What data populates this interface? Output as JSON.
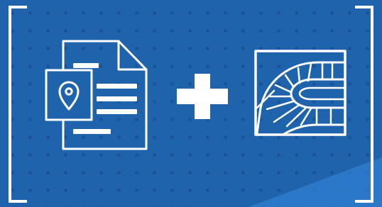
{
  "scene": {
    "background_color": "#1f63ad",
    "dot_color": "#1a5396",
    "corner_accent_color": "#2f7fd0",
    "foreground_color": "#ffffff"
  },
  "icons": {
    "left": "document-with-location-pin-icon",
    "middle": "plus-icon",
    "right": "curved-road-icon"
  }
}
